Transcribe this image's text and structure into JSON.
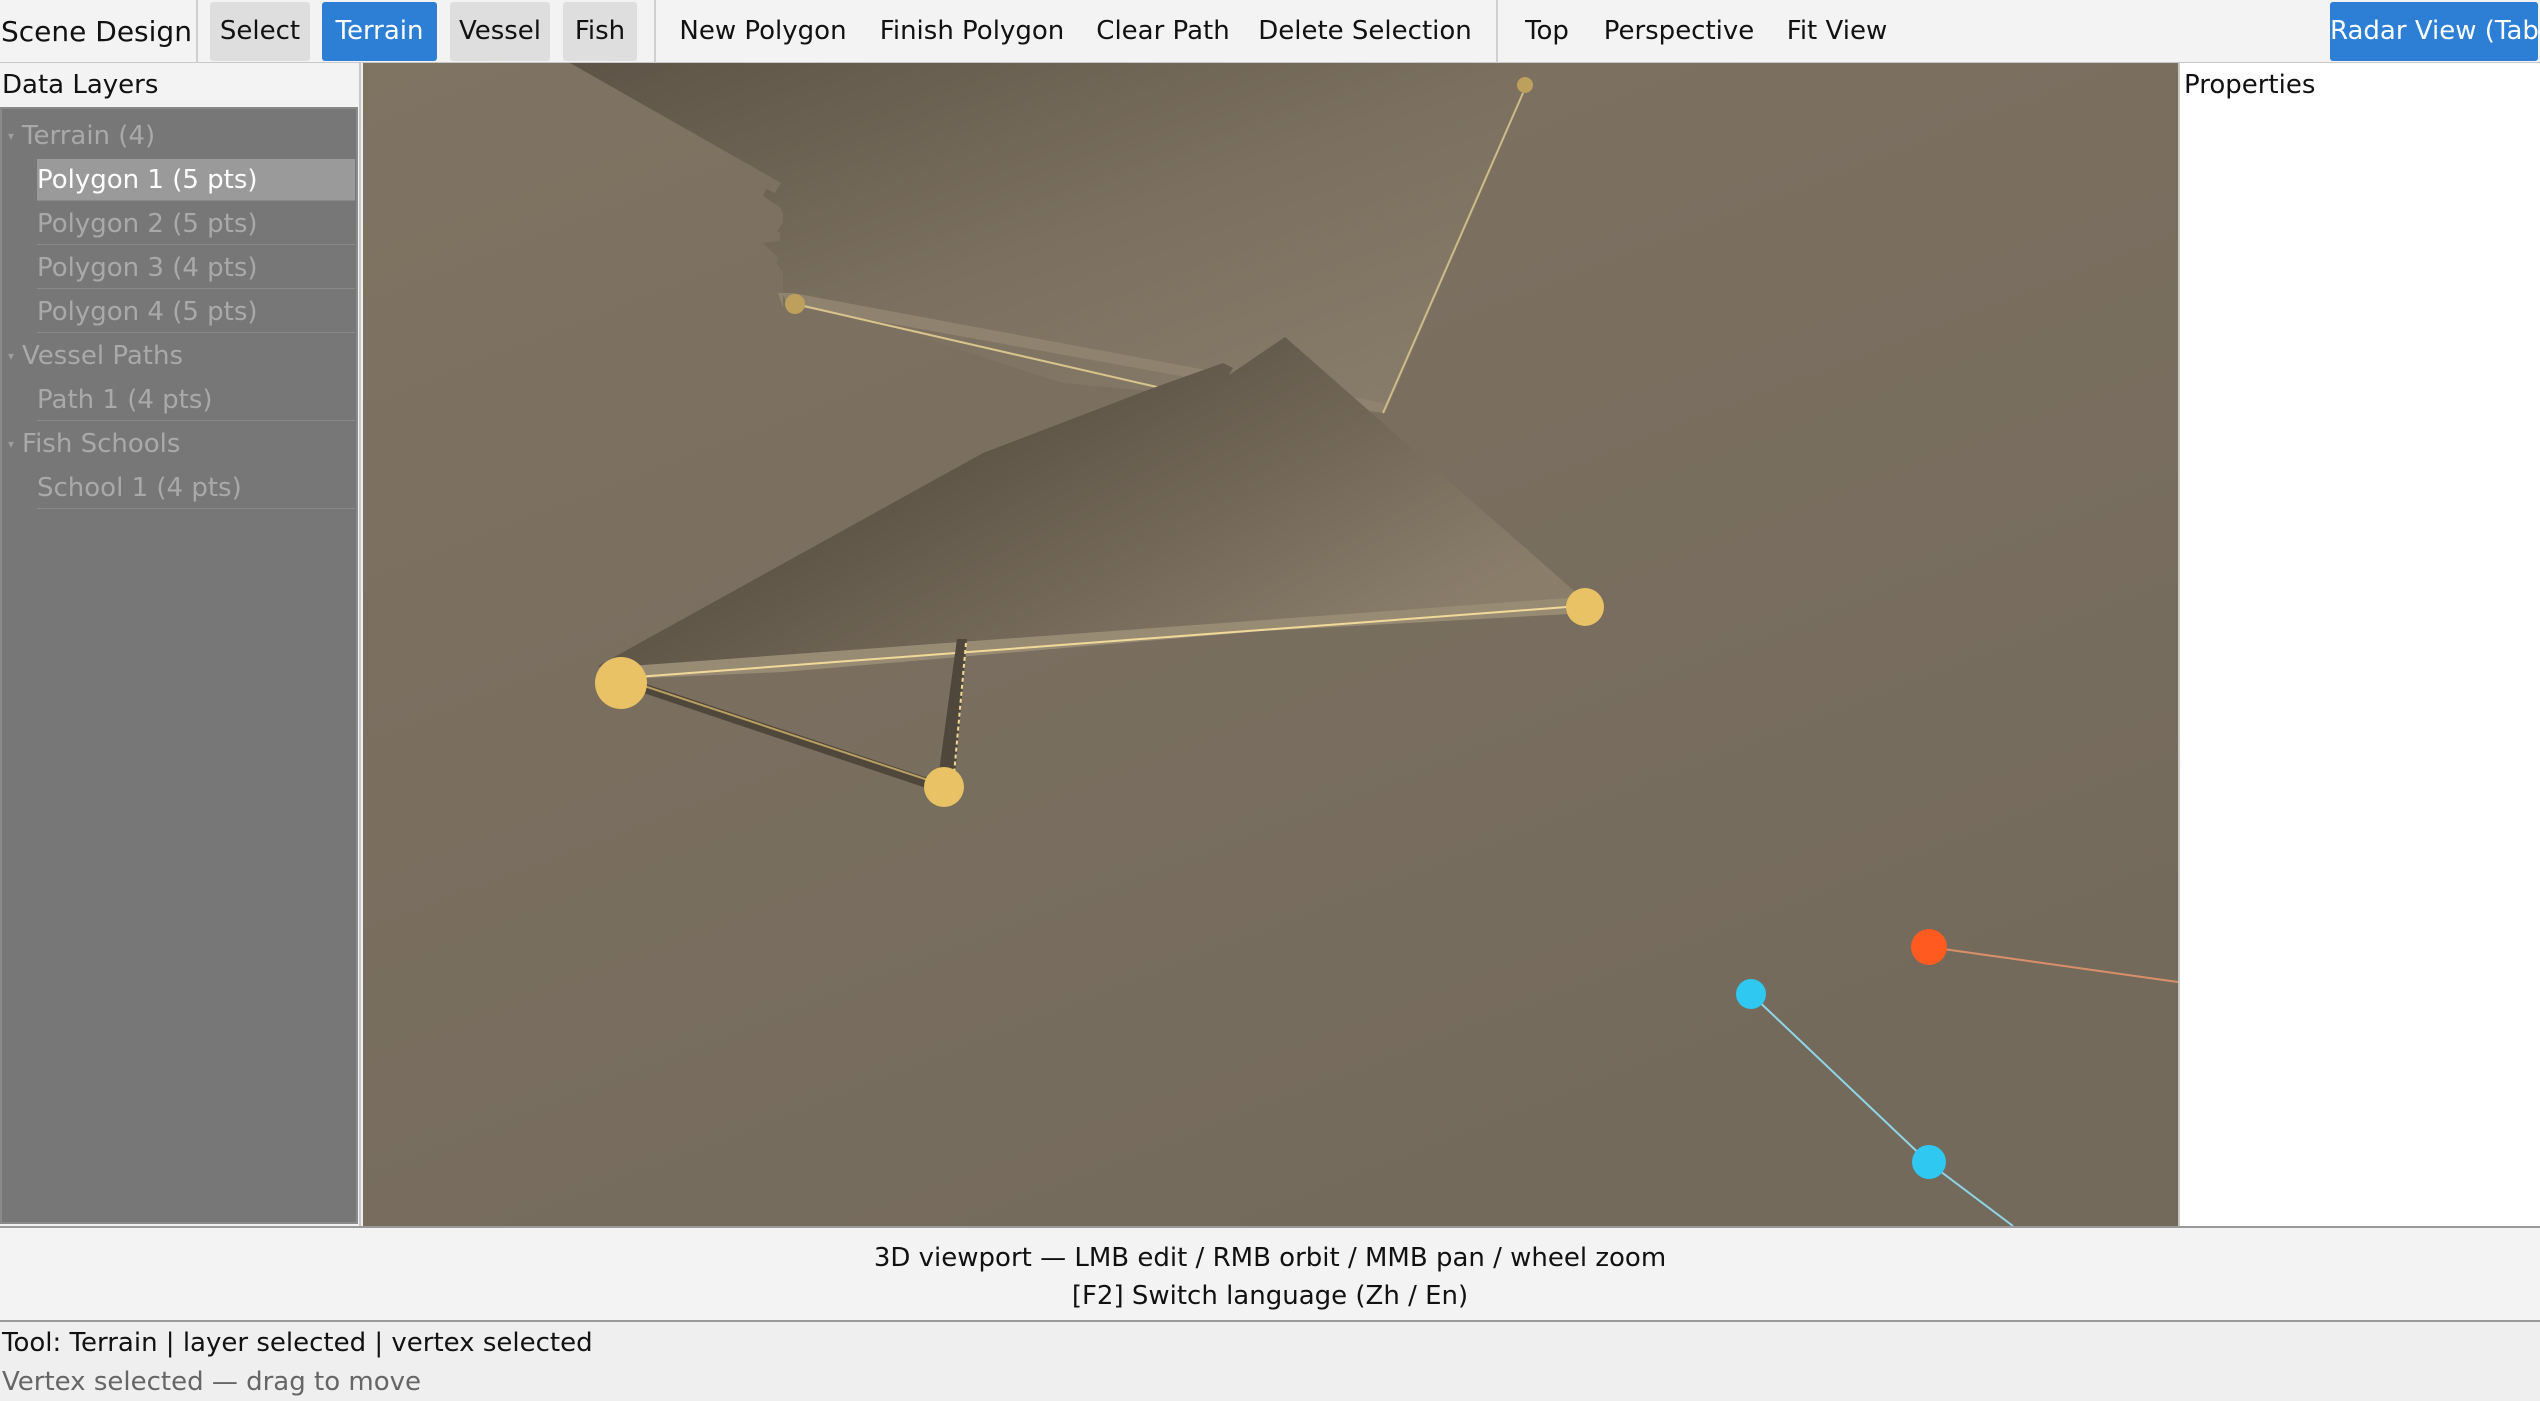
{
  "toolbar": {
    "app_title": "Scene Design",
    "tools": [
      {
        "label": "Select",
        "active": false
      },
      {
        "label": "Terrain",
        "active": true
      },
      {
        "label": "Vessel",
        "active": false
      },
      {
        "label": "Fish",
        "active": false
      }
    ],
    "actions": [
      "New Polygon",
      "Finish Polygon",
      "Clear Path",
      "Delete Selection"
    ],
    "views": [
      "Top",
      "Perspective",
      "Fit View"
    ],
    "radar_button": "Radar View (Tab)"
  },
  "left_panel": {
    "title": "Data Layers",
    "groups": [
      {
        "label": "Terrain (4)",
        "items": [
          "Polygon 1 (5 pts)",
          "Polygon 2 (5 pts)",
          "Polygon 3 (4 pts)",
          "Polygon 4 (5 pts)"
        ]
      },
      {
        "label": "Vessel Paths",
        "items": [
          "Path 1 (4 pts)"
        ]
      },
      {
        "label": "Fish Schools",
        "items": [
          "School 1 (4 pts)"
        ]
      }
    ],
    "selected_item": "Polygon 1 (5 pts)"
  },
  "right_panel": {
    "title": "Properties"
  },
  "hint": {
    "line1": "3D viewport — LMB edit / RMB orbit / MMB pan / wheel zoom",
    "line2": "[F2] Switch language (Zh / En)"
  },
  "status": {
    "line1": "Tool: Terrain | layer selected | vertex selected",
    "line2": "Vertex selected — drag to move"
  },
  "colors": {
    "accent": "#2d7fd6",
    "viewport_background": "#7a6f60",
    "terrain_vertex": "#e8c264",
    "vessel_point": "#2ec8f0",
    "fish_point": "#ff5a1f"
  }
}
